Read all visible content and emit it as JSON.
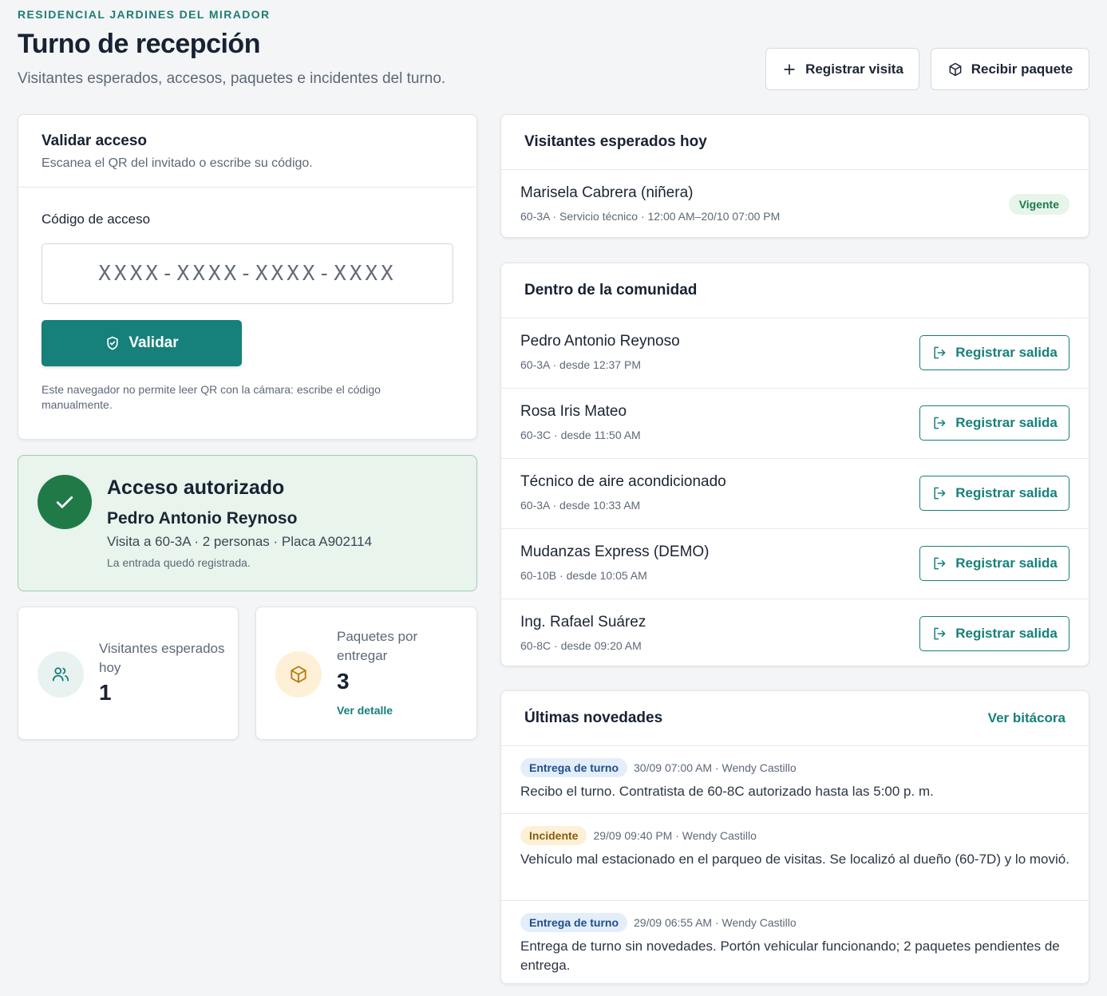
{
  "header": {
    "org": "RESIDENCIAL JARDINES DEL MIRADOR",
    "title": "Turno de recepción",
    "subtitle": "Visitantes esperados, accesos, paquetes e incidentes del turno.",
    "register_visit_label": "Registrar visita",
    "receive_package_label": "Recibir paquete"
  },
  "validate": {
    "title": "Validar acceso",
    "subtitle": "Escanea el QR del invitado o escribe su código.",
    "field_label": "Código de acceso",
    "placeholder": "XXXX-XXXX-XXXX-XXXX",
    "button_label": "Validar",
    "note": "Este navegador no permite leer QR con la cámara: escribe el código manualmente."
  },
  "result": {
    "title": "Acceso autorizado",
    "name": "Pedro Antonio Reynoso",
    "detail": "Visita a 60-3A · 2 personas · Placa A902114",
    "note": "La entrada quedó registrada."
  },
  "stats": {
    "visitors": {
      "label": "Visitantes esperados hoy",
      "value": "1",
      "icon": "users-icon"
    },
    "packages": {
      "label": "Paquetes por entregar",
      "value": "3",
      "link": "Ver detalle",
      "icon": "package-icon"
    }
  },
  "expected": {
    "title": "Visitantes esperados hoy",
    "items": [
      {
        "name": "Marisela Cabrera (niñera)",
        "meta": "60-3A · Servicio técnico · 12:00 AM–20/10 07:00 PM",
        "status": "Vigente"
      }
    ]
  },
  "inside": {
    "title": "Dentro de la comunidad",
    "exit_label": "Registrar salida",
    "items": [
      {
        "name": "Pedro Antonio Reynoso",
        "meta": "60-3A · desde 12:37 PM"
      },
      {
        "name": "Rosa Iris Mateo",
        "meta": "60-3C · desde 11:50 AM"
      },
      {
        "name": "Técnico de aire acondicionado",
        "meta": "60-3A · desde 10:33 AM"
      },
      {
        "name": "Mudanzas Express (DEMO)",
        "meta": "60-10B · desde 10:05 AM"
      },
      {
        "name": "Ing. Rafael Suárez",
        "meta": "60-8C · desde 09:20 AM"
      }
    ]
  },
  "news": {
    "title": "Últimas novedades",
    "link": "Ver bitácora",
    "items": [
      {
        "tag": "Entrega de turno",
        "meta": "30/09 07:00 AM · Wendy Castillo",
        "text": "Recibo el turno. Contratista de 60-8C autorizado hasta las 5:00 p. m."
      },
      {
        "tag": "Incidente",
        "meta": "29/09 09:40 PM · Wendy Castillo",
        "text": "Vehículo mal estacionado en el parqueo de visitas. Se localizó al dueño (60-7D) y lo movió."
      },
      {
        "tag": "Entrega de turno",
        "meta": "29/09 06:55 AM · Wendy Castillo",
        "text": "Entrega de turno sin novedades. Portón vehicular funcionando; 2 paquetes pendientes de entrega."
      }
    ]
  },
  "colors": {
    "accent": "#16807a",
    "success": "#1f7a48",
    "success_bg": "#e8f4ec",
    "amber": "#fdf0d6"
  }
}
